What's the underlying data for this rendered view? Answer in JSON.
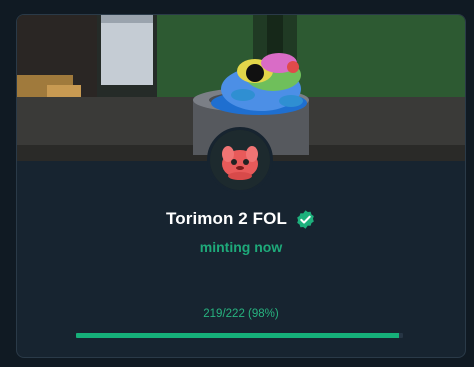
{
  "card": {
    "title": "Torimon 2 FOL",
    "status": "minting now",
    "progress_text": "219/222 (98%)",
    "progress_fraction": 0.9865,
    "verified_icon": "verified-badge-icon"
  },
  "colors": {
    "background": "#101a23",
    "card": "#172430",
    "accent": "#16b07a",
    "title": "#ffffff"
  }
}
